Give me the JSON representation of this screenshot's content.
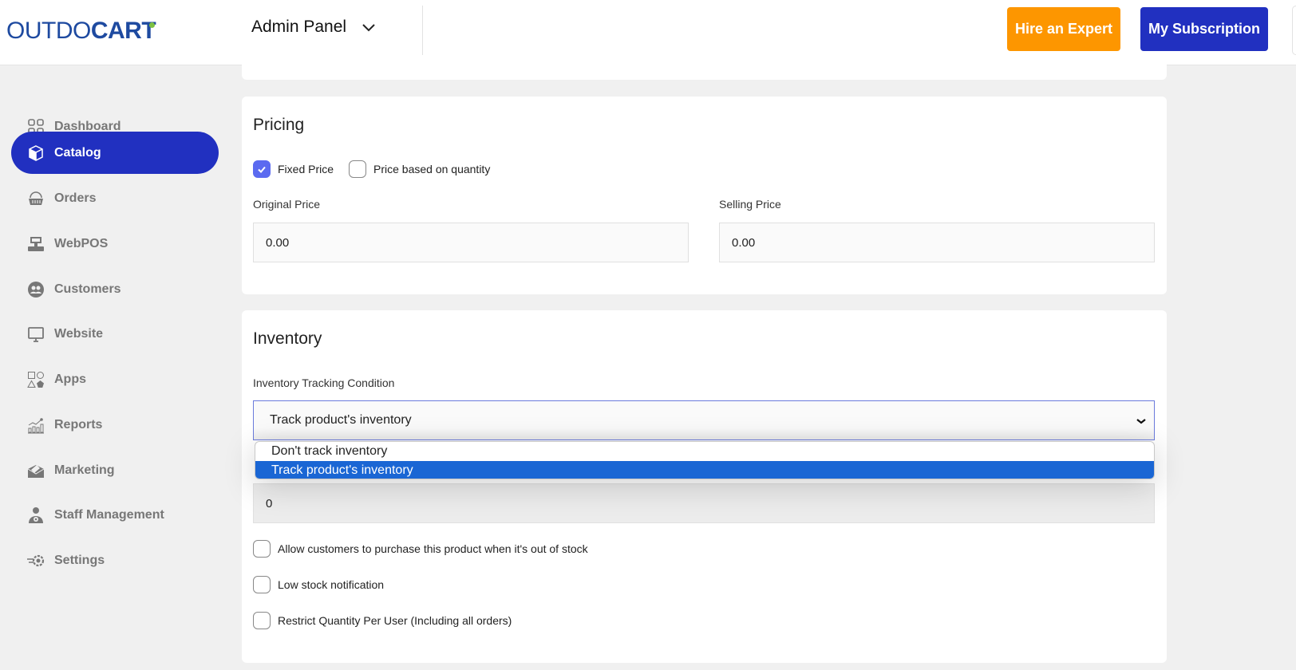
{
  "header": {
    "logo_light": "OUTDO",
    "logo_bold": "CART",
    "panel_label": "Admin Panel",
    "hire_button": "Hire an Expert",
    "subscription_button": "My Subscription",
    "colors": {
      "hire": "#fd9600",
      "subscription": "#2130c0",
      "logo": "#1e4aa0",
      "logo_dot": "#7dc243"
    }
  },
  "sidebar": {
    "items": [
      {
        "label": "Dashboard",
        "icon": "dashboard-grid-icon",
        "active": false
      },
      {
        "label": "Catalog",
        "icon": "catalog-box-icon",
        "active": true
      },
      {
        "label": "Orders",
        "icon": "orders-basket-icon",
        "active": false
      },
      {
        "label": "WebPOS",
        "icon": "webpos-register-icon",
        "active": false
      },
      {
        "label": "Customers",
        "icon": "customers-icon",
        "active": false
      },
      {
        "label": "Website",
        "icon": "website-monitor-icon",
        "active": false
      },
      {
        "label": "Apps",
        "icon": "apps-shapes-icon",
        "active": false
      },
      {
        "label": "Reports",
        "icon": "reports-chart-icon",
        "active": false
      },
      {
        "label": "Marketing",
        "icon": "marketing-envelope-icon",
        "active": false
      },
      {
        "label": "Staff Management",
        "icon": "staff-icon",
        "active": false
      },
      {
        "label": "Settings",
        "icon": "settings-gear-icon",
        "active": false
      }
    ]
  },
  "pricing": {
    "title": "Pricing",
    "fixed_price": {
      "label": "Fixed Price",
      "checked": true
    },
    "quantity_price": {
      "label": "Price based on quantity",
      "checked": false
    },
    "original_price": {
      "label": "Original Price",
      "value": "0.00"
    },
    "selling_price": {
      "label": "Selling Price",
      "value": "0.00"
    }
  },
  "inventory": {
    "title": "Inventory",
    "tracking_label": "Inventory Tracking Condition",
    "tracking_value": "Track product's inventory",
    "options": [
      "Don't track inventory",
      "Track product's inventory"
    ],
    "selected_option_index": 1,
    "quantity_value": "0",
    "checkboxes": [
      {
        "label": "Allow customers to purchase this product when it's out of stock",
        "checked": false
      },
      {
        "label": "Low stock notification",
        "checked": false
      },
      {
        "label": "Restrict Quantity Per User (Including all orders)",
        "checked": false
      }
    ]
  }
}
